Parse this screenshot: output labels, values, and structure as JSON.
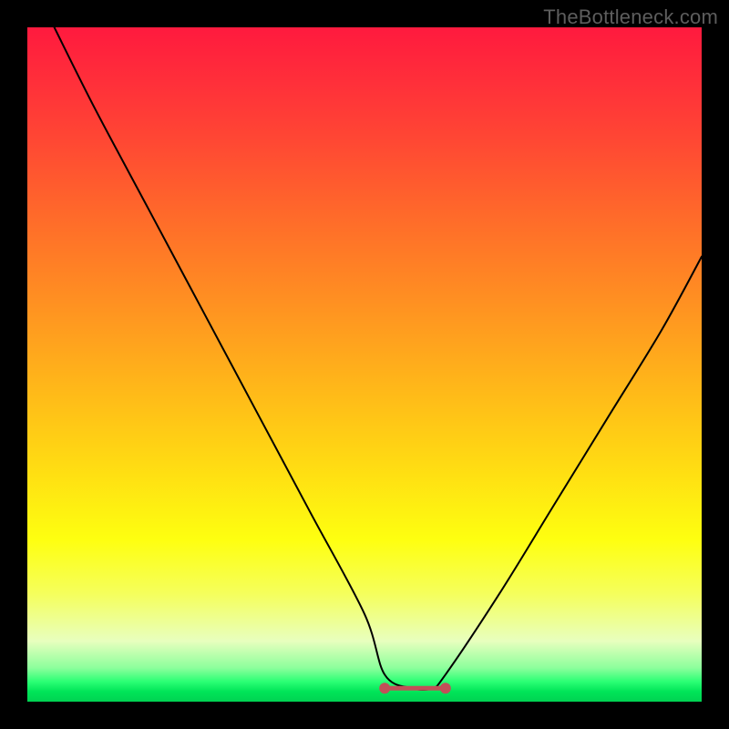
{
  "watermark": "TheBottleneck.com",
  "chart_data": {
    "type": "line",
    "title": "",
    "xlabel": "",
    "ylabel": "",
    "xlim": [
      0,
      100
    ],
    "ylim": [
      0,
      100
    ],
    "grid": false,
    "series": [
      {
        "name": "bottleneck-curve",
        "color": "#000000",
        "x": [
          4,
          10,
          18,
          26,
          34,
          42,
          50,
          53,
          57,
          60,
          62,
          70,
          78,
          86,
          94,
          100
        ],
        "values": [
          100,
          88,
          73,
          58,
          43,
          28,
          13,
          4,
          2,
          2,
          4,
          16,
          29,
          42,
          55,
          66
        ]
      }
    ],
    "flat_segment": {
      "color": "#c25058",
      "x_start": 53,
      "x_end": 62,
      "y": 2,
      "dot_radius_px": 6,
      "stroke_width_px": 5
    }
  }
}
